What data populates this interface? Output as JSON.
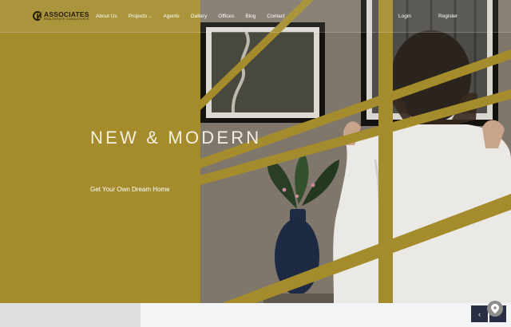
{
  "brand": {
    "name": "ASSOCIATES",
    "tagline": "REAL ESTATE CONSULTANTS"
  },
  "nav": {
    "items": [
      {
        "label": "About Us"
      },
      {
        "label": "Projects",
        "has_dropdown": true
      },
      {
        "label": "Agents"
      },
      {
        "label": "Gallery"
      },
      {
        "label": "Offices"
      },
      {
        "label": "Blog"
      },
      {
        "label": "Contact"
      }
    ],
    "login_label": "Login",
    "register_label": "Register"
  },
  "hero": {
    "headline": "NEW & MODERN",
    "subheadline": "Get Your Own Dream Home"
  },
  "slider": {
    "prev_symbol": "‹"
  },
  "colors": {
    "accent": "#a48c2c",
    "slider_button": "#2b2f44",
    "text_light": "#ffffff"
  },
  "icons": {
    "dropdown": "chevron-down-icon",
    "prev": "chevron-left-icon",
    "map": "map-pin-icon"
  }
}
